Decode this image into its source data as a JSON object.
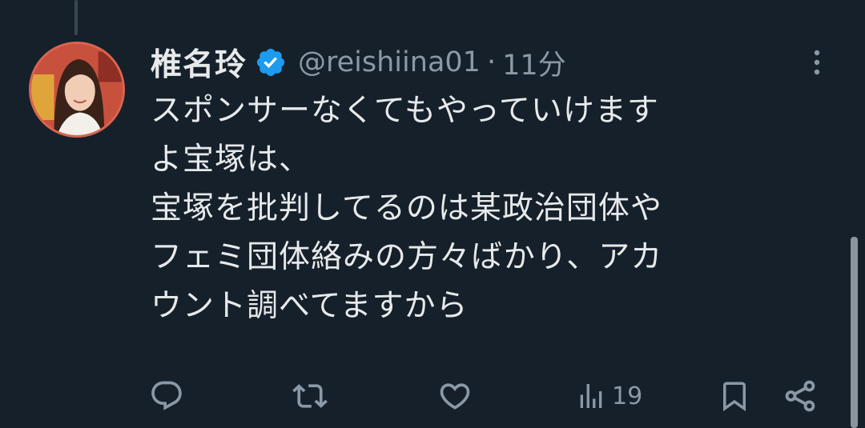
{
  "tweet": {
    "display_name": "椎名玲",
    "verified": true,
    "handle": "@reishiina01",
    "separator": "·",
    "time": "11分",
    "text": "スポンサーなくてもやっていけます\nよ宝塚は、\n宝塚を批判してるのは某政治団体や\nフェミ団体絡みの方々ばかり、アカ\nウント調べてますから"
  },
  "actions": {
    "reply": {
      "icon": "reply-icon"
    },
    "retweet": {
      "icon": "retweet-icon"
    },
    "like": {
      "icon": "heart-icon"
    },
    "views": {
      "icon": "views-icon",
      "count": "19"
    },
    "bookmark": {
      "icon": "bookmark-icon"
    },
    "share": {
      "icon": "share-icon"
    }
  },
  "colors": {
    "background": "#15202b",
    "text": "#e7e9ea",
    "muted": "#8b98a5",
    "verified": "#1d9bf0",
    "avatar_ring": "#d9644e"
  }
}
